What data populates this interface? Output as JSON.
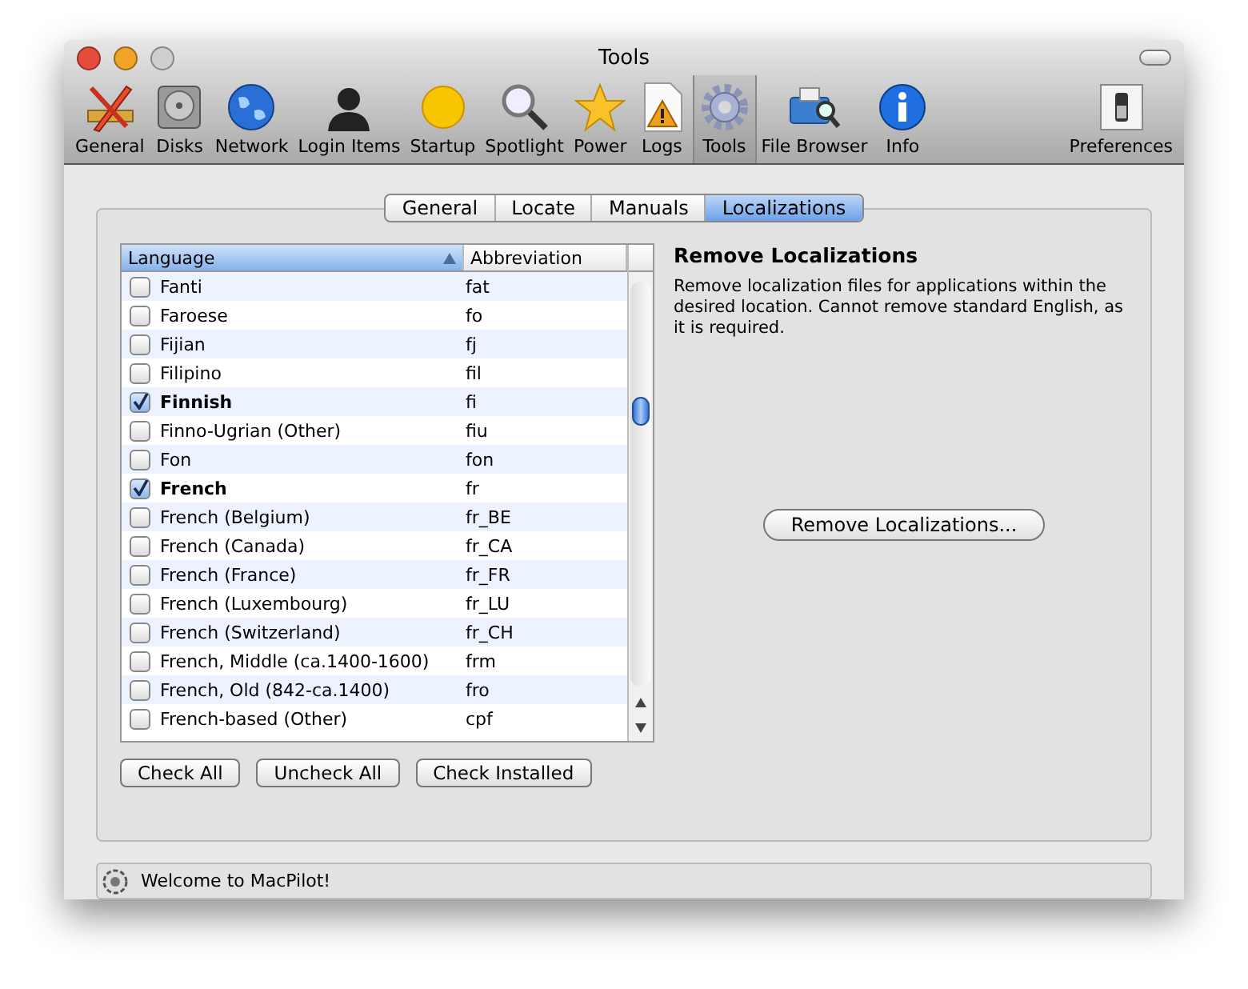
{
  "window": {
    "title": "Tools"
  },
  "toolbar": [
    {
      "label": "General",
      "kind": "ruler",
      "selected": false
    },
    {
      "label": "Disks",
      "kind": "disk",
      "selected": false
    },
    {
      "label": "Network",
      "kind": "globe",
      "selected": false
    },
    {
      "label": "Login Items",
      "kind": "person",
      "selected": false
    },
    {
      "label": "Startup",
      "kind": "sun",
      "selected": false
    },
    {
      "label": "Spotlight",
      "kind": "magnifier",
      "selected": false
    },
    {
      "label": "Power",
      "kind": "star",
      "selected": false
    },
    {
      "label": "Logs",
      "kind": "warning",
      "selected": false
    },
    {
      "label": "Tools",
      "kind": "gear",
      "selected": true
    },
    {
      "label": "File Browser",
      "kind": "folder",
      "selected": false
    },
    {
      "label": "Info",
      "kind": "info",
      "selected": false
    },
    {
      "label": "Preferences",
      "kind": "switch",
      "selected": false
    }
  ],
  "tabs": [
    {
      "label": "General",
      "selected": false
    },
    {
      "label": "Locate",
      "selected": false
    },
    {
      "label": "Manuals",
      "selected": false
    },
    {
      "label": "Localizations",
      "selected": true
    }
  ],
  "table": {
    "columns": [
      "Language",
      "Abbreviation"
    ],
    "rows": [
      {
        "language": "Fanti",
        "abbreviation": "fat",
        "checked": false
      },
      {
        "language": "Faroese",
        "abbreviation": "fo",
        "checked": false
      },
      {
        "language": "Fijian",
        "abbreviation": "fj",
        "checked": false
      },
      {
        "language": "Filipino",
        "abbreviation": "fil",
        "checked": false
      },
      {
        "language": "Finnish",
        "abbreviation": "fi",
        "checked": true
      },
      {
        "language": "Finno-Ugrian (Other)",
        "abbreviation": "fiu",
        "checked": false
      },
      {
        "language": "Fon",
        "abbreviation": "fon",
        "checked": false
      },
      {
        "language": "French",
        "abbreviation": "fr",
        "checked": true
      },
      {
        "language": "French (Belgium)",
        "abbreviation": "fr_BE",
        "checked": false
      },
      {
        "language": "French (Canada)",
        "abbreviation": "fr_CA",
        "checked": false
      },
      {
        "language": "French (France)",
        "abbreviation": "fr_FR",
        "checked": false
      },
      {
        "language": "French (Luxembourg)",
        "abbreviation": "fr_LU",
        "checked": false
      },
      {
        "language": "French (Switzerland)",
        "abbreviation": "fr_CH",
        "checked": false
      },
      {
        "language": "French, Middle (ca.1400-1600)",
        "abbreviation": "frm",
        "checked": false
      },
      {
        "language": "French, Old (842-ca.1400)",
        "abbreviation": "fro",
        "checked": false
      },
      {
        "language": "French-based (Other)",
        "abbreviation": "cpf",
        "checked": false
      }
    ]
  },
  "buttons": [
    "Check All",
    "Uncheck All",
    "Check Installed"
  ],
  "panel": {
    "title": "Remove Localizations",
    "description": "Remove localization files for applications within the desired location. Cannot remove standard English, as it is required.",
    "button": "Remove Localizations..."
  },
  "status_bar": {
    "text": "Welcome to MacPilot!"
  }
}
